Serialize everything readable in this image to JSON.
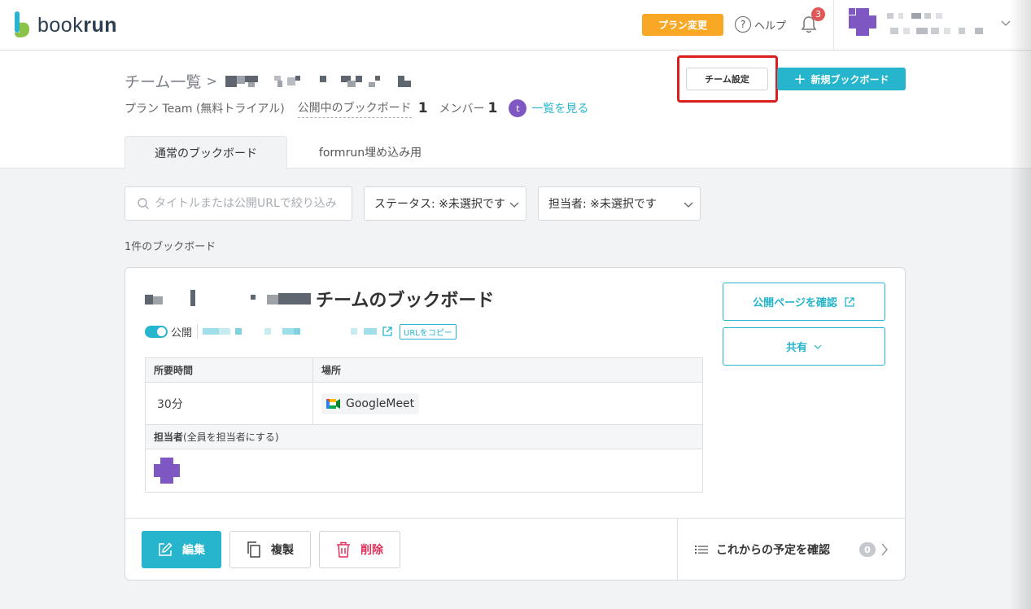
{
  "header": {
    "logo_text_regular": "book",
    "logo_text_bold": "run",
    "plan_change": "プラン変更",
    "help": "ヘルプ",
    "help_icon": "?",
    "notification_count": "3"
  },
  "team": {
    "breadcrumb_root": "チーム一覧",
    "breadcrumb_sep": ">",
    "plan": "プラン Team (無料トライアル)",
    "public_boards_label": "公開中のブックボード",
    "public_boards_count": "1",
    "members_label": "メンバー",
    "members_count": "1",
    "member_initial": "t",
    "view_list": "一覧を見る",
    "team_settings": "チーム設定",
    "new_board": "新規ブックボード",
    "new_board_icon": "+"
  },
  "tabs": [
    {
      "label": "通常のブックボード",
      "active": true
    },
    {
      "label": "formrun埋め込み用",
      "active": false
    }
  ],
  "filters": {
    "search_placeholder": "タイトルまたは公開URLで絞り込み",
    "status": "ステータス: ※未選択です",
    "assignee": "担当者: ※未選択です"
  },
  "count_label": "1件のブックボード",
  "board": {
    "title_suffix": "チームのブックボード",
    "public_label": "公開",
    "url_copy": "URLをコピー",
    "table": {
      "duration_header": "所要時間",
      "location_header": "場所",
      "duration_value": "30分",
      "location_value": "GoogleMeet",
      "assignee_header_bold": "担当者",
      "assignee_header_note": "(全員を担当者にする)"
    },
    "confirm_public_page": "公開ページを確認",
    "share": "共有",
    "edit": "編集",
    "duplicate": "複製",
    "delete": "削除",
    "upcoming": "これからの予定を確認",
    "upcoming_count": "0"
  },
  "colors": {
    "accent": "#26b5cc",
    "plan_button": "#f9a825",
    "delete": "#e0315b",
    "highlight": "#d9201f",
    "avatar_purple": "#7e57c2"
  }
}
